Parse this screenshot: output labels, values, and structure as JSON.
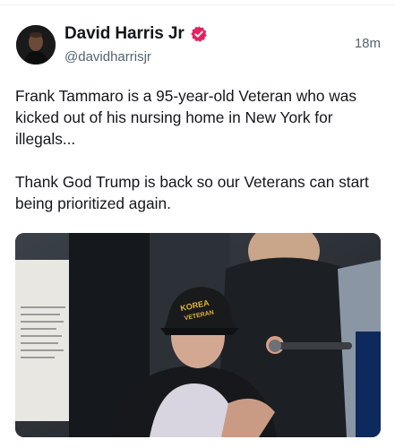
{
  "post": {
    "author": {
      "display_name": "David Harris Jr",
      "handle": "@davidharrisjr",
      "verified": true,
      "avatar_icon": "avatar-photo"
    },
    "timestamp": "18m",
    "text": "Frank Tammaro is a 95-year-old Veteran who was kicked out of his nursing home in New York for illegals...\n\nThank God Trump is back so our Veterans can start being prioritized again.",
    "media": {
      "type": "photo",
      "cap_text": "KOREA VETERAN"
    }
  },
  "colors": {
    "verified_badge": "#e0245e",
    "secondary_text": "#536471",
    "primary_text": "#14171a"
  }
}
